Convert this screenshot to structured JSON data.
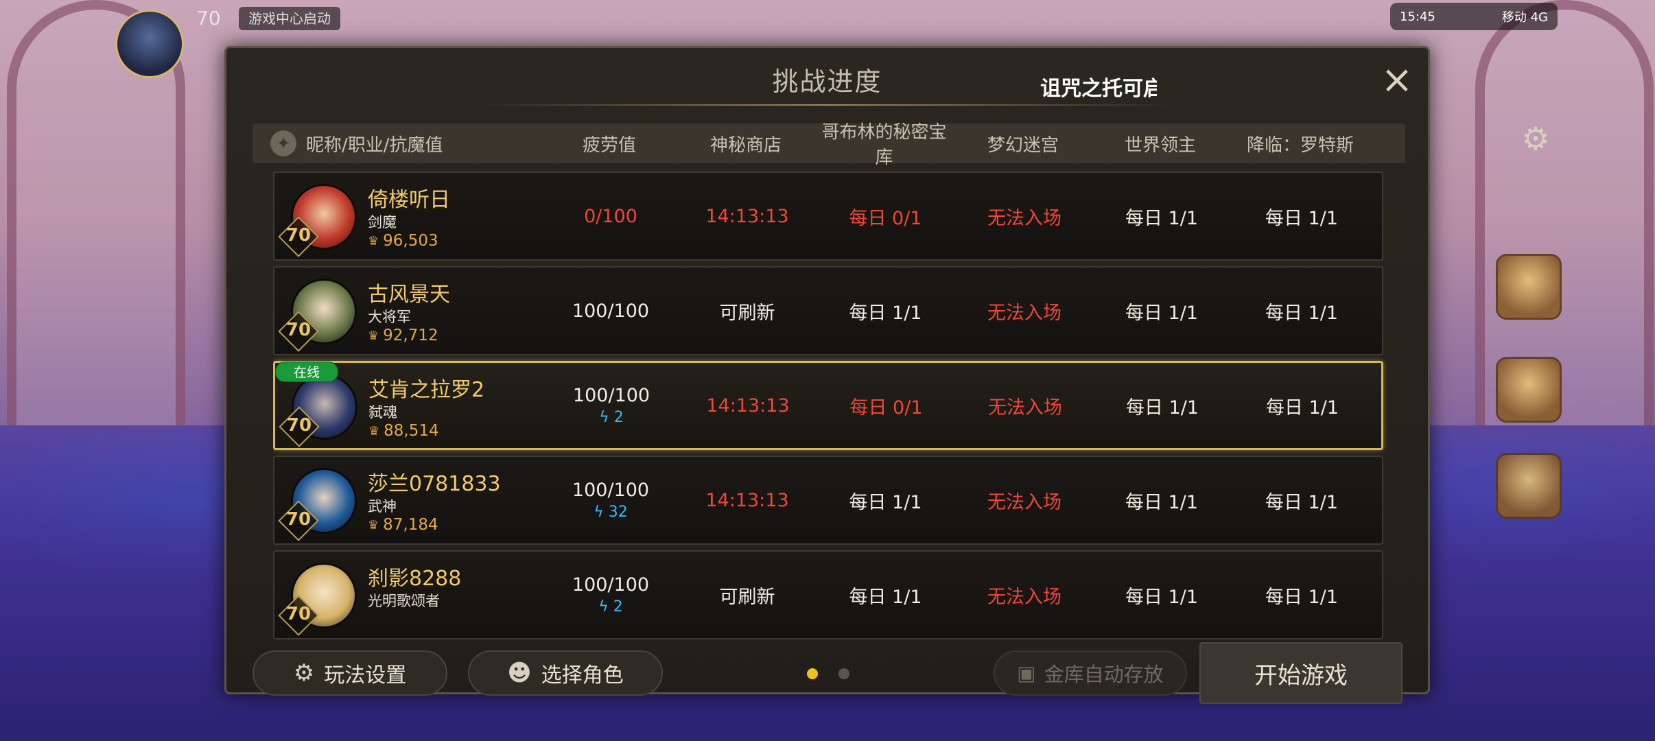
{
  "hud": {
    "level": "70",
    "center_tag": "游戏中心启动",
    "status_time": "15:45",
    "status_extra": "移动 4G"
  },
  "modal": {
    "title": "挑战进度",
    "marquee": "诅咒之托可启",
    "close_icon": "close-icon"
  },
  "columns": {
    "name": "昵称/职业/抗魔值",
    "fatigue": "疲劳值",
    "shop": "神秘商店",
    "goblin": "哥布林的秘密宝库",
    "maze": "梦幻迷宫",
    "boss": "世界领主",
    "rotus": "降临：罗特斯"
  },
  "characters": [
    {
      "name": "倚楼听日",
      "class": "剑魔",
      "power": "96,503",
      "level": "70",
      "online": "",
      "fatigue": "0/100",
      "fatigue_sub": "",
      "fatigue_red": true,
      "shop": "14:13:13",
      "shop_red": true,
      "goblin": "每日 0/1",
      "goblin_red": true,
      "maze": "无法入场",
      "boss": "每日 1/1",
      "rotus": "每日 1/1"
    },
    {
      "name": "古风景天",
      "class": "大将军",
      "power": "92,712",
      "level": "70",
      "online": "",
      "fatigue": "100/100",
      "fatigue_sub": "",
      "fatigue_red": false,
      "shop": "可刷新",
      "shop_red": false,
      "goblin": "每日 1/1",
      "goblin_red": false,
      "maze": "无法入场",
      "boss": "每日 1/1",
      "rotus": "每日 1/1"
    },
    {
      "name": "艾肯之拉罗2",
      "class": "弑魂",
      "power": "88,514",
      "level": "70",
      "online": "在线",
      "fatigue": "100/100",
      "fatigue_sub": "2",
      "fatigue_red": false,
      "shop": "14:13:13",
      "shop_red": true,
      "goblin": "每日 0/1",
      "goblin_red": true,
      "maze": "无法入场",
      "boss": "每日 1/1",
      "rotus": "每日 1/1"
    },
    {
      "name": "莎兰0781833",
      "class": "武神",
      "power": "87,184",
      "level": "70",
      "online": "",
      "fatigue": "100/100",
      "fatigue_sub": "32",
      "fatigue_red": false,
      "shop": "14:13:13",
      "shop_red": true,
      "goblin": "每日 1/1",
      "goblin_red": false,
      "maze": "无法入场",
      "boss": "每日 1/1",
      "rotus": "每日 1/1"
    },
    {
      "name": "刹影8288",
      "class": "光明歌颂者",
      "power": "",
      "level": "70",
      "online": "",
      "fatigue": "100/100",
      "fatigue_sub": "2",
      "fatigue_red": false,
      "shop": "可刷新",
      "shop_red": false,
      "goblin": "每日 1/1",
      "goblin_red": false,
      "maze": "无法入场",
      "boss": "每日 1/1",
      "rotus": "每日 1/1"
    }
  ],
  "bottom": {
    "settings_label": "玩法设置",
    "select_role_label": "选择角色",
    "vault_label": "金库自动存放",
    "start_label": "开始游戏",
    "page_count": 2,
    "active_page": 1
  },
  "colors": {
    "accent_gold": "#f3cc6a",
    "red": "#f2463a",
    "online_green": "#1b9a3a",
    "selected_border": "#d9b85a",
    "fatigue_blue": "#38b8ff"
  }
}
